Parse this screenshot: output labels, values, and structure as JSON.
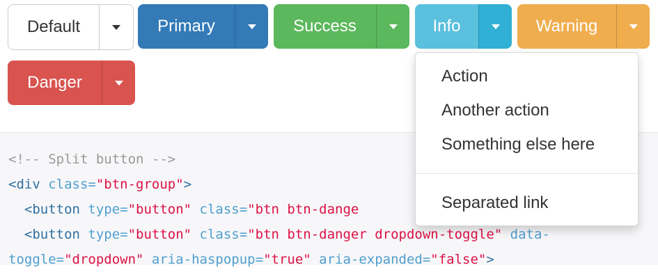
{
  "buttons": [
    {
      "label": "Default",
      "style": "default"
    },
    {
      "label": "Primary",
      "style": "primary"
    },
    {
      "label": "Success",
      "style": "success"
    },
    {
      "label": "Info",
      "style": "info"
    },
    {
      "label": "Warning",
      "style": "warning"
    },
    {
      "label": "Danger",
      "style": "danger"
    }
  ],
  "dropdown": {
    "items": [
      "Action",
      "Another action",
      "Something else here"
    ],
    "separated_item": "Separated link"
  },
  "code": {
    "line1": "<!-- Split button -->",
    "line2_tag": "<div",
    "line2_attr": " class=",
    "line2_val": "\"btn-group\"",
    "line2_end": ">",
    "line3_tag": "  <button",
    "line3_attr1": " type=",
    "line3_val1": "\"button\"",
    "line3_attr2": " class=",
    "line3_val2": "\"btn btn-dange",
    "line4_tag": "  <button",
    "line4_attr1": " type=",
    "line4_val1": "\"button\"",
    "line4_attr2": " class=",
    "line4_val2": "\"btn btn-danger dropdown-toggle\"",
    "line4_attr3": " data-",
    "line5_attr1": "toggle=",
    "line5_val1": "\"dropdown\"",
    "line5_attr2": " aria-haspopup=",
    "line5_val2": "\"true\"",
    "line5_attr3": " aria-expanded=",
    "line5_val3": "\"false\"",
    "line5_end": ">"
  },
  "colors": {
    "primary": "#337ab7",
    "success": "#5cb85c",
    "info": "#5bc0de",
    "warning": "#f0ad4e",
    "danger": "#d9534f"
  }
}
